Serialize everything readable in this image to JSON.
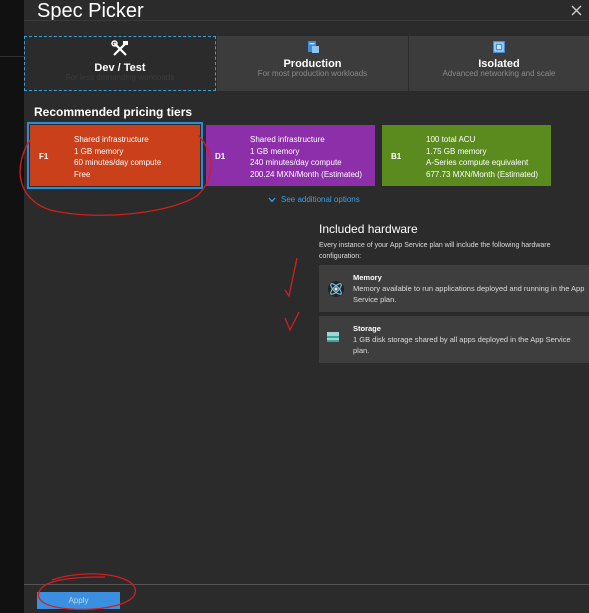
{
  "window": {
    "title": "Spec Picker"
  },
  "tabs": [
    {
      "name": "Dev / Test",
      "sub": "For less demanding workloads",
      "icon": "tools-icon"
    },
    {
      "name": "Production",
      "sub": "For most production workloads",
      "icon": "server-icon"
    },
    {
      "name": "Isolated",
      "sub": "Advanced networking and scale",
      "icon": "isolated-icon"
    }
  ],
  "recommended_heading": "Recommended pricing tiers",
  "tiers": [
    {
      "code": "F1",
      "lines": [
        "Shared infrastructure",
        "1 GB memory",
        "60 minutes/day compute",
        "Free"
      ],
      "color": "#c9401a"
    },
    {
      "code": "D1",
      "lines": [
        "Shared infrastructure",
        "1 GB memory",
        "240 minutes/day compute",
        "200.24 MXN/Month (Estimated)"
      ],
      "color": "#8c2fa8"
    },
    {
      "code": "B1",
      "lines": [
        "100 total ACU",
        "1.75 GB memory",
        "A-Series compute equivalent",
        "677.73 MXN/Month (Estimated)"
      ],
      "color": "#5b8a1f"
    }
  ],
  "see_more": "See additional options",
  "hardware": {
    "title": "Included hardware",
    "desc": "Every instance of your App Service plan will include the following hardware configuration:",
    "items": [
      {
        "name": "Memory",
        "desc": "Memory available to run applications deployed and running in the App Service plan.",
        "icon": "memory-icon"
      },
      {
        "name": "Storage",
        "desc": "1 GB disk storage shared by all apps deployed in the App Service plan.",
        "icon": "storage-icon"
      }
    ]
  },
  "apply_label": "Apply"
}
